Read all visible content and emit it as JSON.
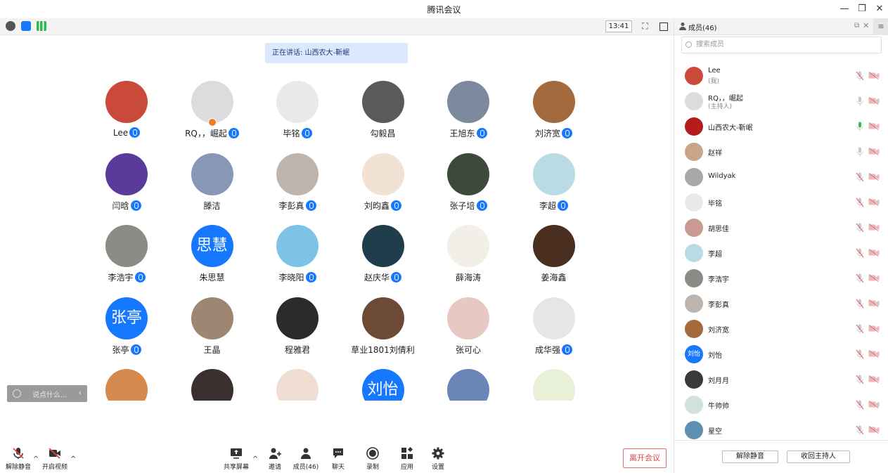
{
  "window": {
    "title": "腾讯会议",
    "minimize": "—",
    "restore": "❐",
    "close": "✕"
  },
  "toolbar": {
    "clock": "13:41"
  },
  "speaking": {
    "text": "正在讲话: 山西农大-靳岷"
  },
  "participants": [
    {
      "name": "Lee",
      "mic": true,
      "avatar_color": "#c94a3b",
      "avatar_text": ""
    },
    {
      "name": "RQ，，崛起",
      "mic": true,
      "avatar_color": "#dcdcdc",
      "avatar_text": ""
    },
    {
      "name": "毕铭",
      "mic": true,
      "avatar_color": "#e9e9e9",
      "avatar_text": ""
    },
    {
      "name": "勾毅昌",
      "mic": false,
      "avatar_color": "#5a5a5a",
      "avatar_text": ""
    },
    {
      "name": "王旭东",
      "mic": true,
      "avatar_color": "#7d8a9e",
      "avatar_text": ""
    },
    {
      "name": "刘济宽",
      "mic": true,
      "avatar_color": "#a36a3e",
      "avatar_text": ""
    },
    {
      "name": "闫晗",
      "mic": true,
      "avatar_color": "#5b3b9a",
      "avatar_text": ""
    },
    {
      "name": "滕洁",
      "mic": false,
      "avatar_color": "#8797b5",
      "avatar_text": ""
    },
    {
      "name": "李彭真",
      "mic": true,
      "avatar_color": "#bdb5ad",
      "avatar_text": ""
    },
    {
      "name": "刘昀鑫",
      "mic": true,
      "avatar_color": "#f1e2d4",
      "avatar_text": ""
    },
    {
      "name": "张子培",
      "mic": true,
      "avatar_color": "#3c4a3a",
      "avatar_text": ""
    },
    {
      "name": "李超",
      "mic": true,
      "avatar_color": "#b9dbe4",
      "avatar_text": ""
    },
    {
      "name": "李浩宇",
      "mic": true,
      "avatar_color": "#8c8c86",
      "avatar_text": ""
    },
    {
      "name": "朱思慧",
      "mic": false,
      "avatar_color": "#1677ff",
      "avatar_text": "思慧"
    },
    {
      "name": "李晓阳",
      "mic": true,
      "avatar_color": "#7dc3e8",
      "avatar_text": ""
    },
    {
      "name": "赵庆华",
      "mic": true,
      "avatar_color": "#1f3d4a",
      "avatar_text": ""
    },
    {
      "name": "薛海涛",
      "mic": false,
      "avatar_color": "#f2efe8",
      "avatar_text": ""
    },
    {
      "name": "姜海鑫",
      "mic": false,
      "avatar_color": "#4a2e20",
      "avatar_text": ""
    },
    {
      "name": "张亭",
      "mic": true,
      "avatar_color": "#1677ff",
      "avatar_text": "张亭"
    },
    {
      "name": "王晶",
      "mic": false,
      "avatar_color": "#9d8672",
      "avatar_text": ""
    },
    {
      "name": "程雅君",
      "mic": false,
      "avatar_color": "#2b2b2b",
      "avatar_text": ""
    },
    {
      "name": "草业1801刘倩利",
      "mic": false,
      "avatar_color": "#6d4a36",
      "avatar_text": ""
    },
    {
      "name": "张可心",
      "mic": false,
      "avatar_color": "#e8c8c2",
      "avatar_text": ""
    },
    {
      "name": "成华强",
      "mic": true,
      "avatar_color": "#e6e6e6",
      "avatar_text": ""
    },
    {
      "name": "",
      "mic": false,
      "avatar_color": "#d68a4e",
      "avatar_text": ""
    },
    {
      "name": "",
      "mic": false,
      "avatar_color": "#3b3030",
      "avatar_text": ""
    },
    {
      "name": "",
      "mic": false,
      "avatar_color": "#f0ddd2",
      "avatar_text": ""
    },
    {
      "name": "",
      "mic": false,
      "avatar_color": "#1677ff",
      "avatar_text": "刘怡"
    },
    {
      "name": "",
      "mic": false,
      "avatar_color": "#6a86b8",
      "avatar_text": ""
    },
    {
      "name": "",
      "mic": false,
      "avatar_color": "#e9f0d8",
      "avatar_text": ""
    }
  ],
  "chat": {
    "placeholder": "说点什么...",
    "collapse": "‹"
  },
  "bottom": {
    "unmute": "解除静音",
    "start_video": "开启视频",
    "share_screen": "共享屏幕",
    "invite": "邀请",
    "members": "成员(46)",
    "chat": "聊天",
    "record": "录制",
    "apps": "应用",
    "settings": "设置",
    "leave": "离开会议"
  },
  "panel": {
    "title": "成员(46)",
    "search_placeholder": "搜索成员",
    "members": [
      {
        "name": "Lee",
        "sub": "(我)",
        "avatar_color": "#c94a3b",
        "avatar_text": "",
        "mic": "muted",
        "cam": "off"
      },
      {
        "name": "RQ，，崛起",
        "sub": "(主持人)",
        "avatar_color": "#dcdcdc",
        "avatar_text": "",
        "mic": "on",
        "cam": "off"
      },
      {
        "name": "山西农大-靳岷",
        "sub": "",
        "avatar_color": "#b71c1c",
        "avatar_text": "",
        "mic": "speaking",
        "cam": "off"
      },
      {
        "name": "赵祥",
        "sub": "",
        "avatar_color": "#c9a58a",
        "avatar_text": "",
        "mic": "on",
        "cam": "off"
      },
      {
        "name": "Wildyak",
        "sub": "",
        "avatar_color": "#a8a8a8",
        "avatar_text": "",
        "mic": "muted",
        "cam": "off"
      },
      {
        "name": "毕铭",
        "sub": "",
        "avatar_color": "#e9e9e9",
        "avatar_text": "",
        "mic": "muted",
        "cam": "off"
      },
      {
        "name": "胡思佳",
        "sub": "",
        "avatar_color": "#c89a92",
        "avatar_text": "",
        "mic": "muted",
        "cam": "off"
      },
      {
        "name": "李超",
        "sub": "",
        "avatar_color": "#b9dbe4",
        "avatar_text": "",
        "mic": "muted",
        "cam": "off"
      },
      {
        "name": "李浩宇",
        "sub": "",
        "avatar_color": "#8c8c86",
        "avatar_text": "",
        "mic": "muted",
        "cam": "off"
      },
      {
        "name": "李彭真",
        "sub": "",
        "avatar_color": "#bdb5ad",
        "avatar_text": "",
        "mic": "muted",
        "cam": "off"
      },
      {
        "name": "刘济宽",
        "sub": "",
        "avatar_color": "#a36a3e",
        "avatar_text": "",
        "mic": "muted",
        "cam": "off"
      },
      {
        "name": "刘怡",
        "sub": "",
        "avatar_color": "#1677ff",
        "avatar_text": "刘怡",
        "mic": "muted",
        "cam": "off"
      },
      {
        "name": "刘月月",
        "sub": "",
        "avatar_color": "#3a3a3a",
        "avatar_text": "",
        "mic": "muted",
        "cam": "off"
      },
      {
        "name": "牛帅帅",
        "sub": "",
        "avatar_color": "#cfe3da",
        "avatar_text": "",
        "mic": "muted",
        "cam": "off"
      },
      {
        "name": "星空",
        "sub": "",
        "avatar_color": "#5f8fb0",
        "avatar_text": "",
        "mic": "muted",
        "cam": "off"
      }
    ],
    "unmute_all": "解除静音",
    "reclaim_host": "收回主持人"
  }
}
